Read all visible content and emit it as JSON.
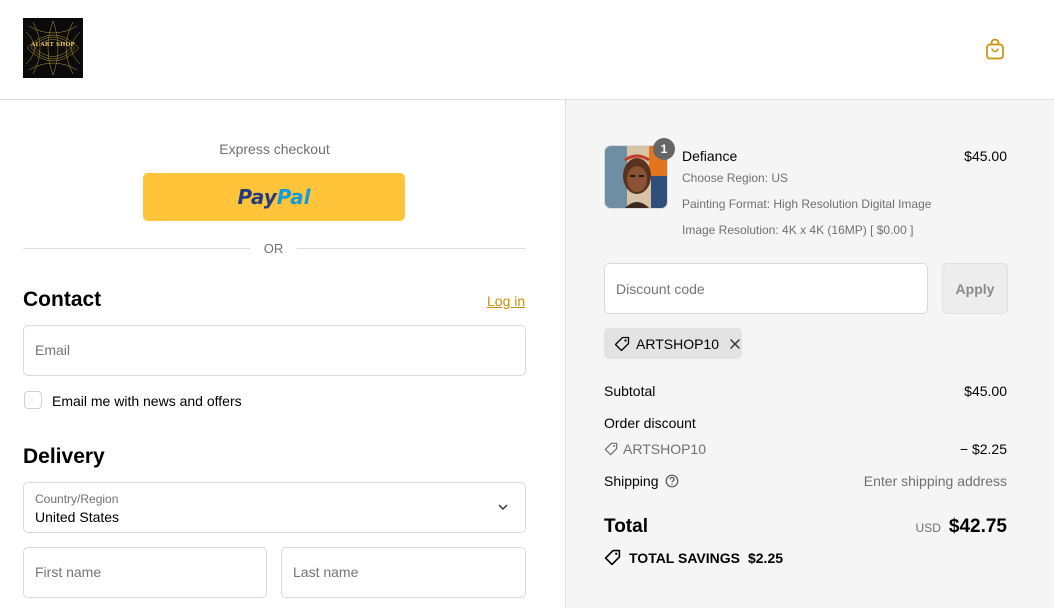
{
  "header": {
    "logo_text": "AI ART SHOP",
    "cart_icon": "shopping-bag-icon",
    "accent_color": "#c8920a"
  },
  "express": {
    "title": "Express checkout",
    "paypal_part1": "Pay",
    "paypal_part2": "Pal",
    "or_text": "OR"
  },
  "contact": {
    "title": "Contact",
    "login_label": "Log in",
    "email_placeholder": "Email",
    "newsletter_label": "Email me with news and offers"
  },
  "delivery": {
    "title": "Delivery",
    "country_label": "Country/Region",
    "country_value": "United States",
    "first_name_placeholder": "First name",
    "last_name_placeholder": "Last name"
  },
  "order": {
    "item": {
      "quantity": "1",
      "name": "Defiance",
      "price": "$45.00",
      "region": "Choose Region: US",
      "format": "Painting Format: High Resolution Digital Image",
      "resolution": "Image Resolution: 4K x 4K (16MP) [ $0.00 ]"
    },
    "discount_placeholder": "Discount code",
    "apply_label": "Apply",
    "applied_code": "ARTSHOP10",
    "subtotal_label": "Subtotal",
    "subtotal_value": "$45.00",
    "order_discount_label": "Order discount",
    "discount_code": "ARTSHOP10",
    "discount_value": "− $2.25",
    "shipping_label": "Shipping",
    "shipping_value": "Enter shipping address",
    "total_label": "Total",
    "currency": "USD",
    "total_value": "$42.75",
    "savings_label": "TOTAL SAVINGS",
    "savings_value": "$2.25"
  }
}
